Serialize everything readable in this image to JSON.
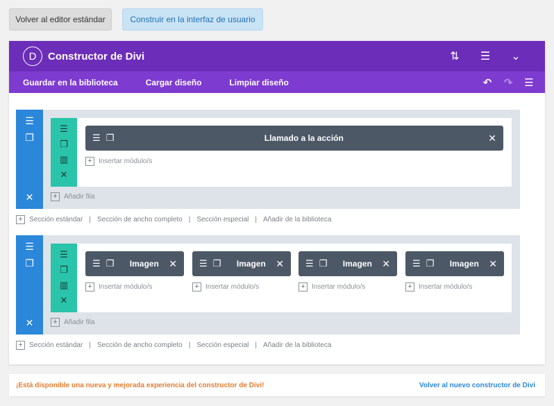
{
  "top_buttons": {
    "standard_editor": "Volver al editor estándar",
    "visual_builder": "Construir en la interfaz de usuario"
  },
  "builder": {
    "logo_letter": "D",
    "title": "Constructor de Divi",
    "header_icons": [
      "sort-icon",
      "menu-icon",
      "chevron-down-icon"
    ],
    "toolbar": {
      "save_library": "Guardar en la biblioteca",
      "load_layout": "Cargar diseño",
      "clear_layout": "Limpiar diseño",
      "icons": [
        "undo-icon",
        "redo-icon",
        "history-icon"
      ]
    }
  },
  "sections": [
    {
      "modules": [
        "Llamado a la acción"
      ],
      "insert_label": "Insertar módulo/s",
      "add_row": "Añadir fila"
    },
    {
      "modules": [
        "Imagen",
        "Imagen",
        "Imagen",
        "Imagen"
      ],
      "insert_label": "Insertar módulo/s",
      "add_row": "Añadir fila"
    }
  ],
  "section_links": {
    "standard": "Sección estándar",
    "fullwidth": "Sección de ancho completo",
    "special": "Sección especial",
    "library": "Añadir de la biblioteca",
    "separator": "|"
  },
  "notice": {
    "message": "¡Está disponible una nueva y mejorada experiencia del constructor de Divi!",
    "link": "Volver al nuevo constructor de Divi"
  },
  "colors": {
    "header": "#6c2eb9",
    "subheader": "#7e3bd0",
    "section_blue": "#2b87da",
    "row_teal": "#29c4a9",
    "module_dark": "#4c5866"
  }
}
